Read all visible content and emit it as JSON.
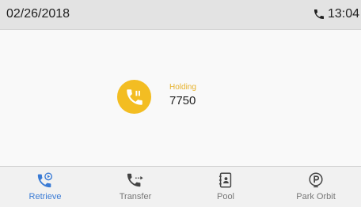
{
  "status_bar": {
    "date": "02/26/2018",
    "time": "13:04",
    "call_icon": "phone-icon"
  },
  "call": {
    "status_label": "Holding",
    "number": "7750",
    "icon": "phone-hold-icon",
    "accent_color": "#f3bd22"
  },
  "softkeys": [
    {
      "label": "Retrieve",
      "icon": "retrieve-call-icon",
      "active": true
    },
    {
      "label": "Transfer",
      "icon": "transfer-call-icon",
      "active": false
    },
    {
      "label": "Pool",
      "icon": "contact-book-icon",
      "active": false
    },
    {
      "label": "Park Orbit",
      "icon": "park-orbit-icon",
      "active": false
    }
  ],
  "colors": {
    "active_softkey": "#3a7bd5",
    "inactive_softkey": "#444444"
  }
}
